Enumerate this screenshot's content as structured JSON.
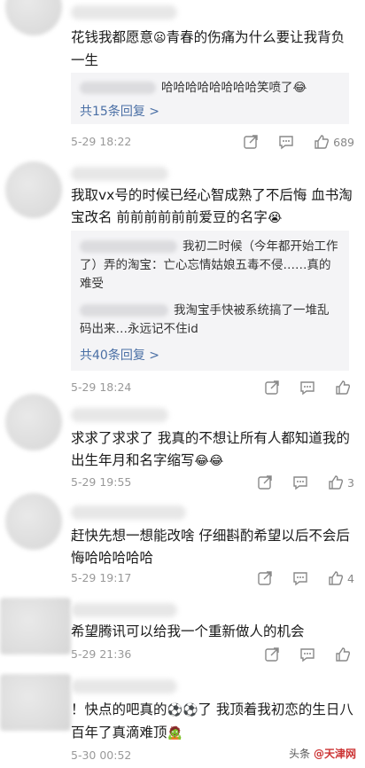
{
  "comments": [
    {
      "text": "花钱我都愿意",
      "emoji1": "😦",
      "text2": "青春的伤痛为什么要让我背负一生",
      "reply_line": "哈哈哈哈哈哈哈哈笑喷了",
      "reply_emoji": "😂",
      "reply_count": "共15条回复 >",
      "date": "5-29 18:22",
      "likes": "689"
    },
    {
      "text": "我取vx号的时候已经心智成熟了不后悔 血书淘宝改名 前前前前前前爱豆的名字",
      "emoji1": "😭",
      "reply1": "我初二时候（今年都开始工作了）弄的淘宝：亡心忘情姑娘五毒不侵……真的难受",
      "reply2": "我淘宝手快被系统搞了一堆乱码出来…永远记不住id",
      "reply_count": "共40条回复 >",
      "date": "5-29 18:24",
      "likes": ""
    },
    {
      "text": "求求了求求了 我真的不想让所有人都知道我的出生年月和名字缩写",
      "emoji1": "😂😂",
      "date": "5-29 19:55",
      "likes": "3"
    },
    {
      "text": "赶快先想一想能改啥 仔细斟酌希望以后不会后悔哈哈哈哈哈",
      "date": "5-29 19:17",
      "likes": "4"
    },
    {
      "text": "希望腾讯可以给我一个重新做人的机会",
      "date": "5-29 21:36",
      "likes": ""
    },
    {
      "text": "！快点的吧真的",
      "emoji1": "⚽⚽",
      "text2": "了 我顶着我初恋的生日八百年了真滴难顶",
      "emoji2": "🧟",
      "date": "5-30 00:52",
      "likes": ""
    }
  ],
  "watermark": {
    "prefix": "头条",
    "name": "@天津网"
  },
  "icons": [
    "share-icon",
    "comment-icon",
    "like-icon"
  ]
}
